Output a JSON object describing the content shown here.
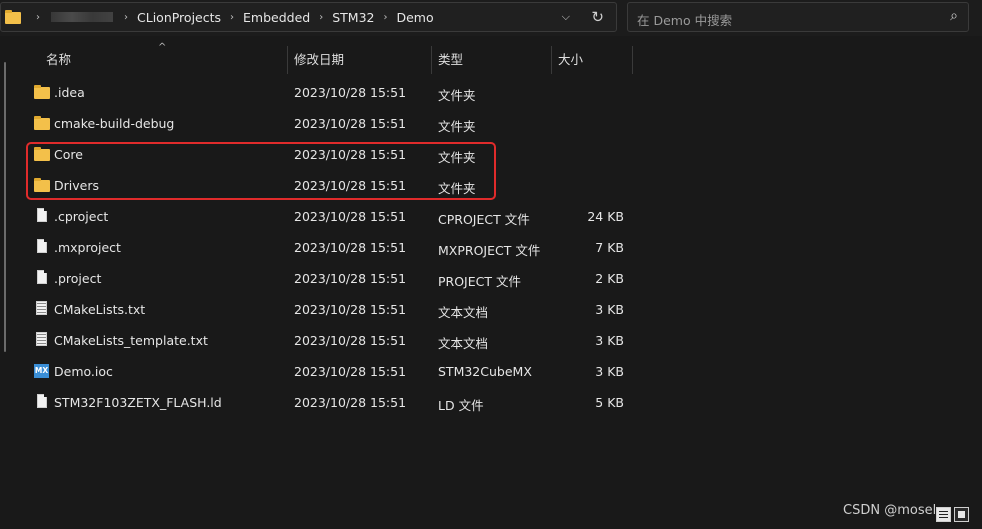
{
  "address_bar": {
    "breadcrumbs": [
      "CLionProjects",
      "Embedded",
      "STM32",
      "Demo"
    ]
  },
  "search": {
    "placeholder": "在 Demo 中搜索"
  },
  "columns": {
    "name": "名称",
    "date": "修改日期",
    "type": "类型",
    "size": "大小"
  },
  "files": [
    {
      "name": ".idea",
      "date": "2023/10/28 15:51",
      "type": "文件夹",
      "size": "",
      "icon": "folder-icon"
    },
    {
      "name": "cmake-build-debug",
      "date": "2023/10/28 15:51",
      "type": "文件夹",
      "size": "",
      "icon": "folder-icon"
    },
    {
      "name": "Core",
      "date": "2023/10/28 15:51",
      "type": "文件夹",
      "size": "",
      "icon": "folder-icon"
    },
    {
      "name": "Drivers",
      "date": "2023/10/28 15:51",
      "type": "文件夹",
      "size": "",
      "icon": "folder-icon"
    },
    {
      "name": ".cproject",
      "date": "2023/10/28 15:51",
      "type": "CPROJECT 文件",
      "size": "24 KB",
      "icon": "file-icon"
    },
    {
      "name": ".mxproject",
      "date": "2023/10/28 15:51",
      "type": "MXPROJECT 文件",
      "size": "7 KB",
      "icon": "file-icon"
    },
    {
      "name": ".project",
      "date": "2023/10/28 15:51",
      "type": "PROJECT 文件",
      "size": "2 KB",
      "icon": "file-icon"
    },
    {
      "name": "CMakeLists.txt",
      "date": "2023/10/28 15:51",
      "type": "文本文档",
      "size": "3 KB",
      "icon": "text-file-icon"
    },
    {
      "name": "CMakeLists_template.txt",
      "date": "2023/10/28 15:51",
      "type": "文本文档",
      "size": "3 KB",
      "icon": "text-file-icon"
    },
    {
      "name": "Demo.ioc",
      "date": "2023/10/28 15:51",
      "type": "STM32CubeMX",
      "size": "3 KB",
      "icon": "stm32cubemx-icon"
    },
    {
      "name": "STM32F103ZETX_FLASH.ld",
      "date": "2023/10/28 15:51",
      "type": "LD 文件",
      "size": "5 KB",
      "icon": "file-icon"
    }
  ],
  "watermark": "CSDN @mosel"
}
